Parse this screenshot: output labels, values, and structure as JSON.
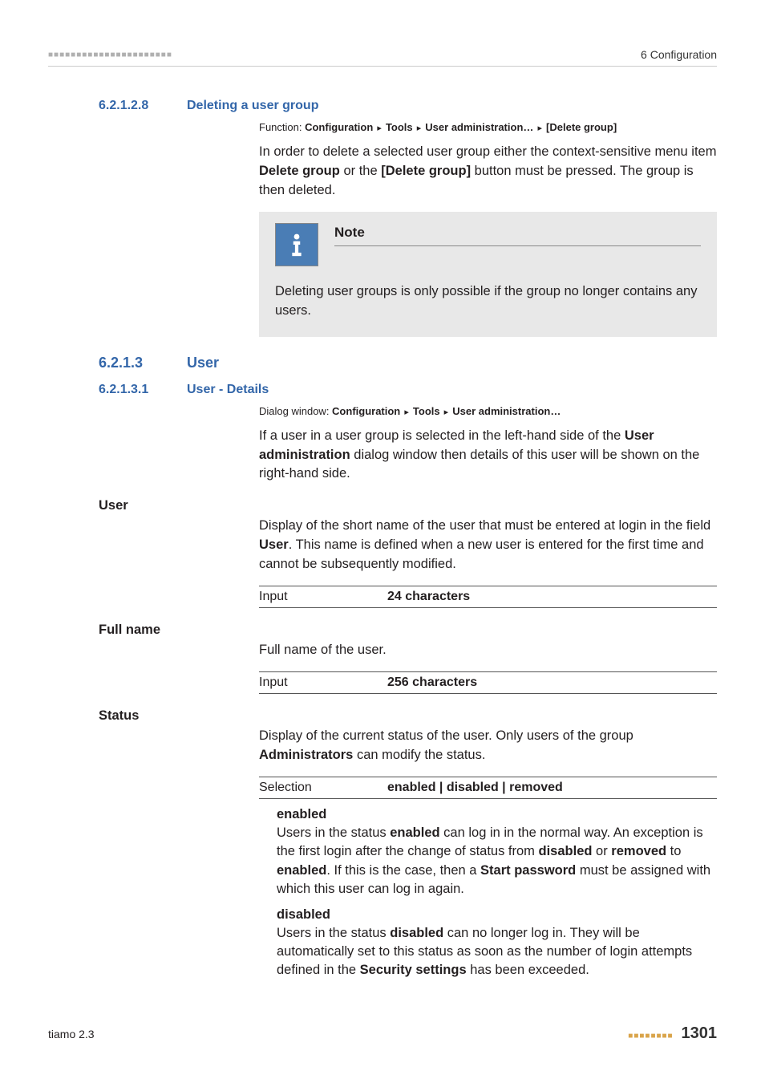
{
  "header": {
    "chapter": "6 Configuration"
  },
  "sections": {
    "s1": {
      "num": "6.2.1.2.8",
      "title": "Deleting a user group"
    },
    "s1_bc_prefix": "Function: ",
    "s1_bc": [
      "Configuration",
      "Tools",
      "User administration…",
      "[Delete group]"
    ],
    "s1_para_a": "In order to delete a selected user group either the context-sensitive menu item ",
    "s1_para_b": "Delete group",
    "s1_para_c": " or the ",
    "s1_para_d": "[Delete group]",
    "s1_para_e": " button must be pressed. The group is then deleted.",
    "note_title": "Note",
    "note_body": "Deleting user groups is only possible if the group no longer contains any users.",
    "s2": {
      "num": "6.2.1.3",
      "title": "User"
    },
    "s3": {
      "num": "6.2.1.3.1",
      "title": "User - Details"
    },
    "s3_bc_prefix": "Dialog window: ",
    "s3_bc": [
      "Configuration",
      "Tools",
      "User administration…"
    ],
    "s3_para_a": "If a user in a user group is selected in the left-hand side of the ",
    "s3_para_b": "User administration",
    "s3_para_c": " dialog window then details of this user will be shown on the right-hand side."
  },
  "fields": {
    "user": {
      "label": "User",
      "desc_a": "Display of the short name of the user that must be entered at login in the field ",
      "desc_b": "User",
      "desc_c": ". This name is defined when a new user is entered for the first time and cannot be subsequently modified.",
      "spec_label": "Input",
      "spec_value": "24 characters"
    },
    "fullname": {
      "label": "Full name",
      "desc": "Full name of the user.",
      "spec_label": "Input",
      "spec_value": "256 characters"
    },
    "status": {
      "label": "Status",
      "desc_a": "Display of the current status of the user. Only users of the group ",
      "desc_b": "Administrators",
      "desc_c": " can modify the status.",
      "spec_label": "Selection",
      "spec_value": "enabled | disabled | removed",
      "enabled": {
        "name": "enabled",
        "t1": "Users in the status ",
        "t2": "enabled",
        "t3": " can log in in the normal way. An exception is the first login after the change of status from ",
        "t4": "disabled",
        "t5": " or ",
        "t6": "removed",
        "t7": " to ",
        "t8": "enabled",
        "t9": ". If this is the case, then a ",
        "t10": "Start password",
        "t11": " must be assigned with which this user can log in again."
      },
      "disabled": {
        "name": "disabled",
        "t1": "Users in the status ",
        "t2": "disabled",
        "t3": " can no longer log in. They will be automatically set to this status as soon as the number of login attempts defined in the ",
        "t4": "Security settings",
        "t5": " has been exceeded."
      }
    }
  },
  "footer": {
    "product": "tiamo 2.3",
    "page": "1301"
  }
}
